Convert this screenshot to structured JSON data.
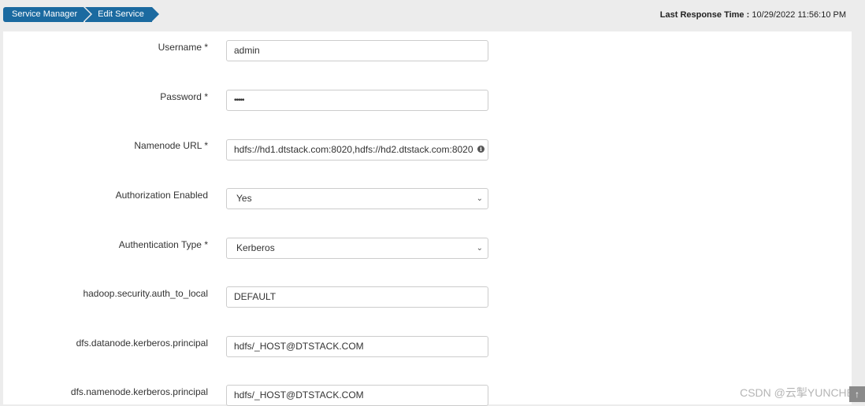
{
  "breadcrumb": {
    "items": [
      "Service Manager",
      "Edit Service"
    ]
  },
  "header": {
    "last_response_label": "Last Response Time :",
    "last_response_value": "10/29/2022 11:56:10 PM"
  },
  "form": {
    "username": {
      "label": "Username *",
      "value": "admin"
    },
    "password": {
      "label": "Password *",
      "value": "•••••"
    },
    "namenode_url": {
      "label": "Namenode URL *",
      "value": "hdfs://hd1.dtstack.com:8020,hdfs://hd2.dtstack.com:8020",
      "icon": "info-icon"
    },
    "authorization_enabled": {
      "label": "Authorization Enabled",
      "value": "Yes"
    },
    "authentication_type": {
      "label": "Authentication Type *",
      "value": "Kerberos"
    },
    "auth_to_local": {
      "label": "hadoop.security.auth_to_local",
      "value": "DEFAULT"
    },
    "datanode_principal": {
      "label": "dfs.datanode.kerberos.principal",
      "value": "hdfs/_HOST@DTSTACK.COM"
    },
    "namenode_principal": {
      "label": "dfs.namenode.kerberos.principal",
      "value": "hdfs/_HOST@DTSTACK.COM"
    }
  },
  "watermark": "CSDN @云掣YUNCHE",
  "colors": {
    "accent": "#1b6aa0",
    "background": "#ececec",
    "panel": "#ffffff"
  }
}
